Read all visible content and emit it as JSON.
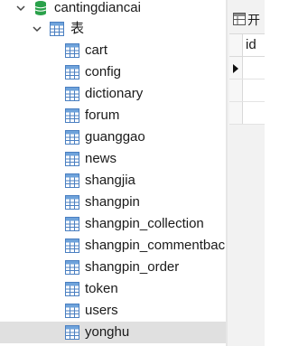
{
  "tree": {
    "database": {
      "name": "cantingdiancai",
      "icon": "database-icon"
    },
    "tables_group": {
      "label": "表",
      "icon": "table-group-icon"
    },
    "tables": [
      "cart",
      "config",
      "dictionary",
      "forum",
      "guanggao",
      "news",
      "shangjia",
      "shangpin",
      "shangpin_collection",
      "shangpin_commentback",
      "shangpin_order",
      "token",
      "users",
      "yonghu"
    ],
    "selected_table": "yonghu"
  },
  "right_panel": {
    "toolbar": {
      "open_label": "开",
      "icon": "open-table-icon"
    },
    "grid": {
      "column_header": "id",
      "row_marker": "current-row-icon"
    }
  },
  "colors": {
    "database_icon": "#2aa14a",
    "table_icon_border": "#4a7fc1",
    "table_icon_header": "#6fa3db",
    "selected_row": "#e0e0e0"
  }
}
